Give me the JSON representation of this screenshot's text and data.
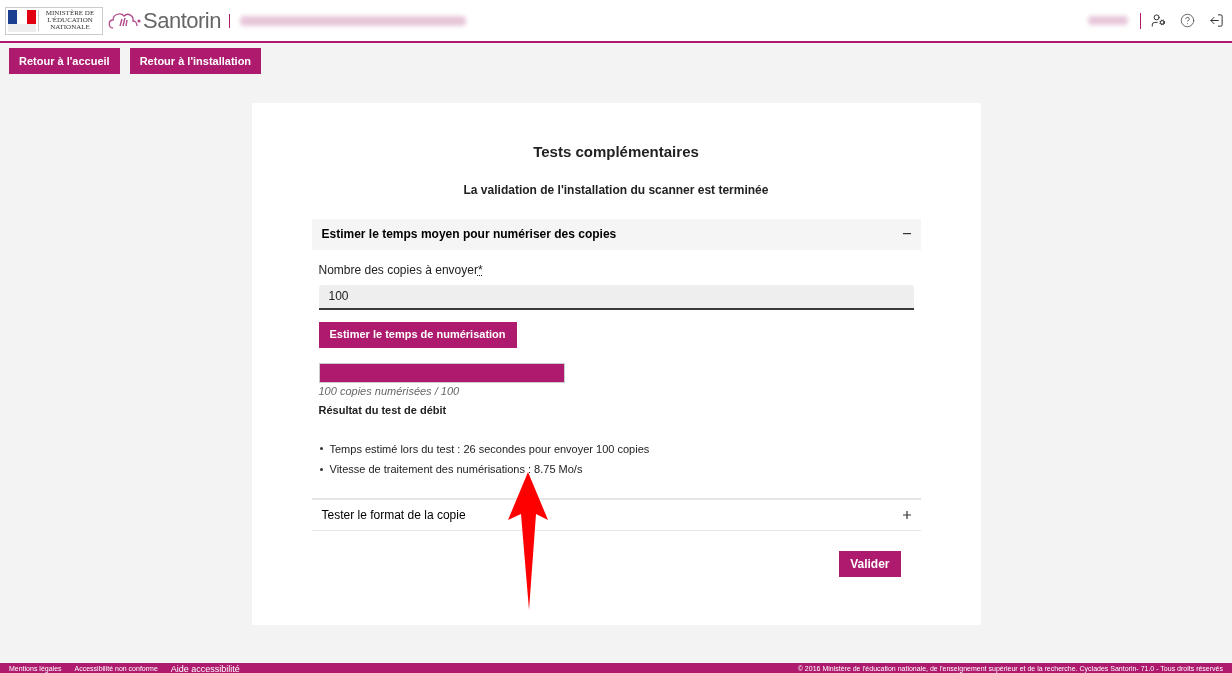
{
  "header": {
    "ministry": "MINISTÈRE DE L'ÉDUCATION NATIONALE",
    "app_name": "Santorin"
  },
  "nav_buttons": [
    "Retour à l'accueil",
    "Retour à l'installation"
  ],
  "card": {
    "title": "Tests complémentaires",
    "subtitle": "La validation de l'installation du scanner est terminée",
    "sections": [
      {
        "title": "Estimer le temps moyen pour numériser des copies",
        "expanded": true,
        "field_label": "Nombre des copies à envoyer",
        "required_mark": "*",
        "field_value": "100",
        "action": "Estimer le temps de numérisation",
        "progress": {
          "level": 1.0,
          "caption": "100 copies numérisées / 100"
        },
        "result_title": "Résultat du test de débit",
        "results": [
          "Temps estimé lors du test : 26 secondes pour envoyer 100 copies",
          "Vitesse de traitement des numérisations : 8.75 Mo/s"
        ]
      },
      {
        "title": "Tester le format de la copie",
        "expanded": false
      }
    ],
    "submit": "Valider"
  },
  "footer": {
    "links": [
      "Mentions légales",
      "Accessibilité non conforme",
      "Aide accessibilité"
    ],
    "copyright": "© 2016 Ministère de l'éducation nationale, de l'enseignement supérieur et de la recherche. Cyclades Santorin- 71.0 - Tous droits réservés"
  }
}
